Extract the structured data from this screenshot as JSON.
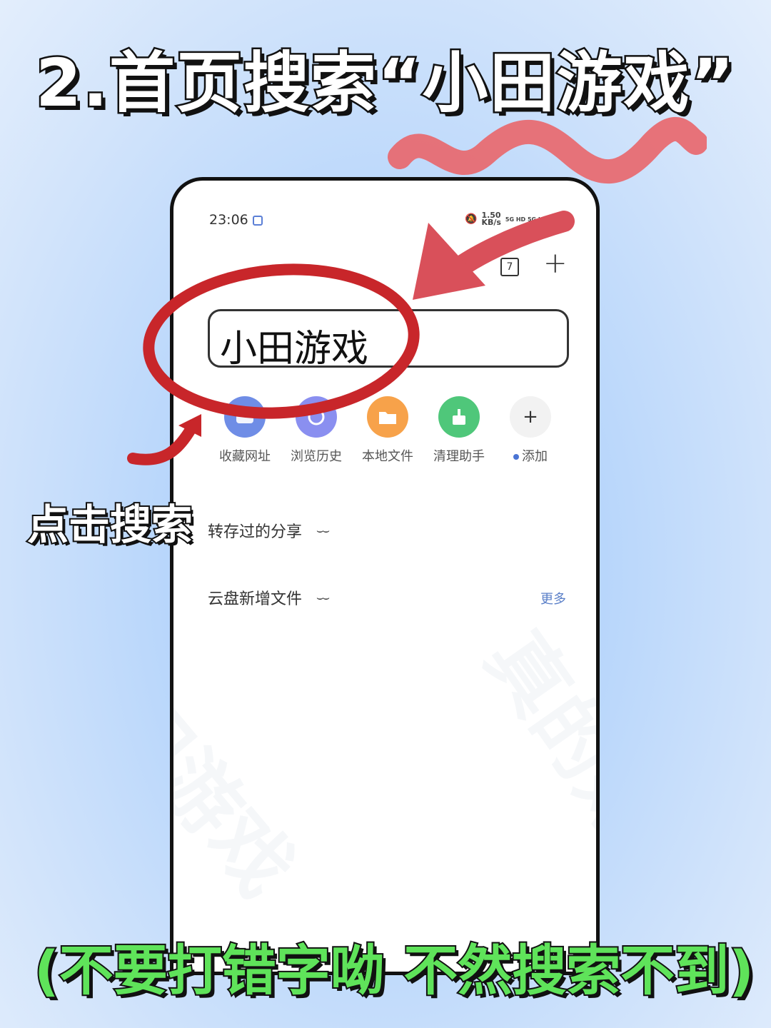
{
  "headline": "2.首页搜索“小田游戏”",
  "status_bar": {
    "time": "23:06",
    "speed_value": "1.50",
    "speed_unit": "KB/s",
    "network": "5G HD 5G HD"
  },
  "toolbar": {
    "tab_count": "7",
    "add_icon": "plus-icon"
  },
  "search": {
    "query": "小田游戏"
  },
  "shortcuts": [
    {
      "label": "收藏网址",
      "icon": "bookmark-icon",
      "color": "#6f8de6"
    },
    {
      "label": "浏览历史",
      "icon": "history-icon",
      "color": "#8a8ff0"
    },
    {
      "label": "本地文件",
      "icon": "folder-icon",
      "color": "#f7a24a"
    },
    {
      "label": "清理助手",
      "icon": "broom-icon",
      "color": "#4fc77a"
    },
    {
      "label": "添加",
      "icon": "plus-icon",
      "color": "#f2f2f2"
    }
  ],
  "sections": {
    "saved_shares": "转存过的分享",
    "cloud_new_files": "云盘新增文件",
    "more": "更多"
  },
  "annotations": {
    "tap_hint": "点击搜索",
    "warning": "(不要打错字呦 不然搜索不到)"
  },
  "watermarks": [
    "小田游戏",
    "真的好玩"
  ],
  "colors": {
    "highlight_circle": "#c8262a",
    "arrow": "#d9505a",
    "squiggle": "#e8686e",
    "warning_text": "#5fe35a"
  }
}
